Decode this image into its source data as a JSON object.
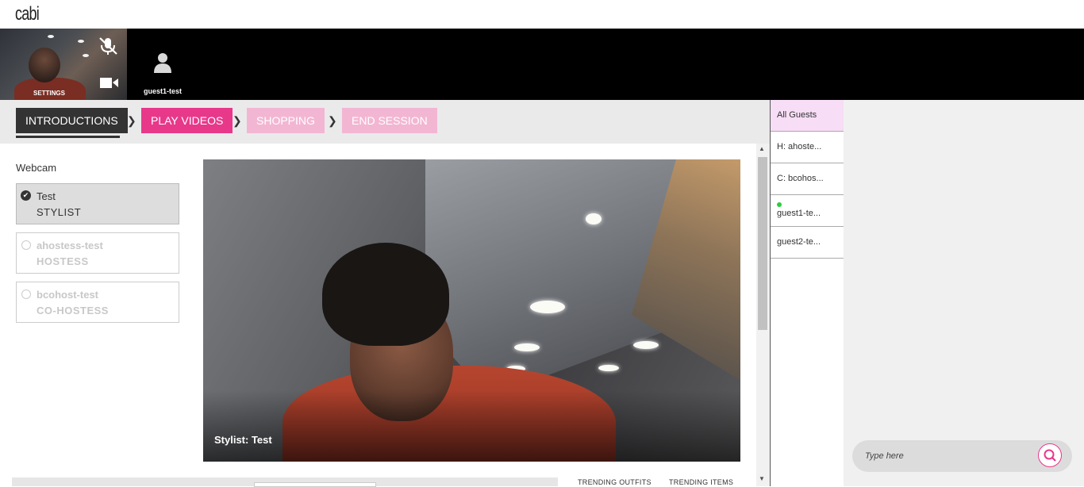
{
  "app": {
    "logo": "cabi"
  },
  "video_strip": {
    "self_label": "SETTINGS",
    "guest_name": "guest1-test"
  },
  "steps": [
    {
      "label": "INTRODUCTIONS"
    },
    {
      "label": "PLAY VIDEOS"
    },
    {
      "label": "SHOPPING"
    },
    {
      "label": "END SESSION"
    }
  ],
  "webcam": {
    "title": "Webcam",
    "options": [
      {
        "name": "Test",
        "role": "STYLIST",
        "selected": true
      },
      {
        "name": "ahostess-test",
        "role": "HOSTESS",
        "selected": false
      },
      {
        "name": "bcohost-test",
        "role": "CO-HOSTESS",
        "selected": false
      }
    ]
  },
  "main_video": {
    "caption": "Stylist: Test"
  },
  "tabs_bottom": {
    "trending_outfits": "TRENDING OUTFITS",
    "trending_items": "TRENDING ITEMS"
  },
  "guests": {
    "all": "All Guests",
    "items": [
      {
        "label": "H: ahoste...",
        "online": false
      },
      {
        "label": "C: bcohos...",
        "online": false
      },
      {
        "label": "guest1-te...",
        "online": true
      },
      {
        "label": "guest2-te...",
        "online": false
      }
    ]
  },
  "chat": {
    "placeholder": "Type here"
  },
  "colors": {
    "accent": "#e8388a",
    "accent_faded": "#f2b6d3",
    "active_step": "#333333",
    "guest_selected": "#f7ddf6",
    "online": "#2ecc40"
  },
  "icons": [
    "mic-muted-icon",
    "video-camera-icon",
    "user-icon",
    "check-icon",
    "radio-icon",
    "chevron-right-icon",
    "search-icon"
  ]
}
